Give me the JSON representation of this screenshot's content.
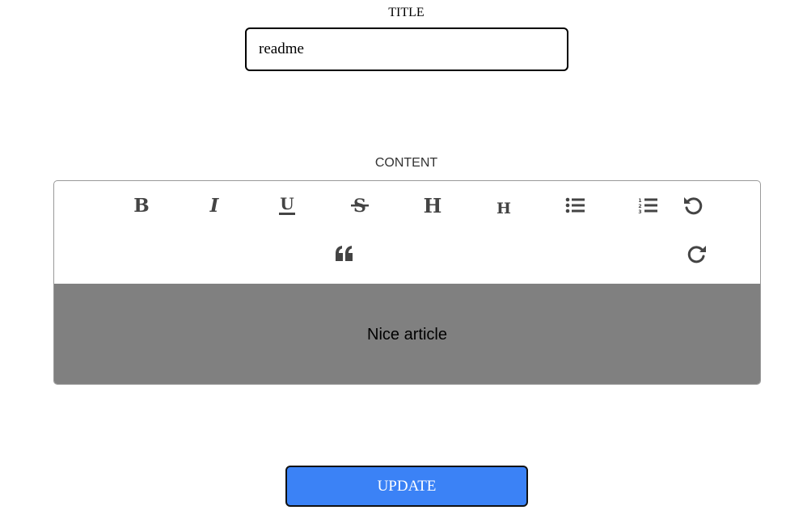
{
  "title_field": {
    "label": "TITLE",
    "value": "readme"
  },
  "content_field": {
    "label": "CONTENT"
  },
  "toolbar": {
    "icons": [
      "bold-icon",
      "italic-icon",
      "underline-icon",
      "strikethrough-icon",
      "heading-icon",
      "heading-small-icon",
      "bullet-list-icon",
      "numbered-list-icon",
      "undo-icon",
      "blockquote-icon",
      "redo-icon"
    ],
    "icon_color": "#444444"
  },
  "editor": {
    "text": "Nice article",
    "background": "#808080"
  },
  "actions": {
    "update_label": "UPDATE",
    "update_color": "#3b82f6"
  }
}
